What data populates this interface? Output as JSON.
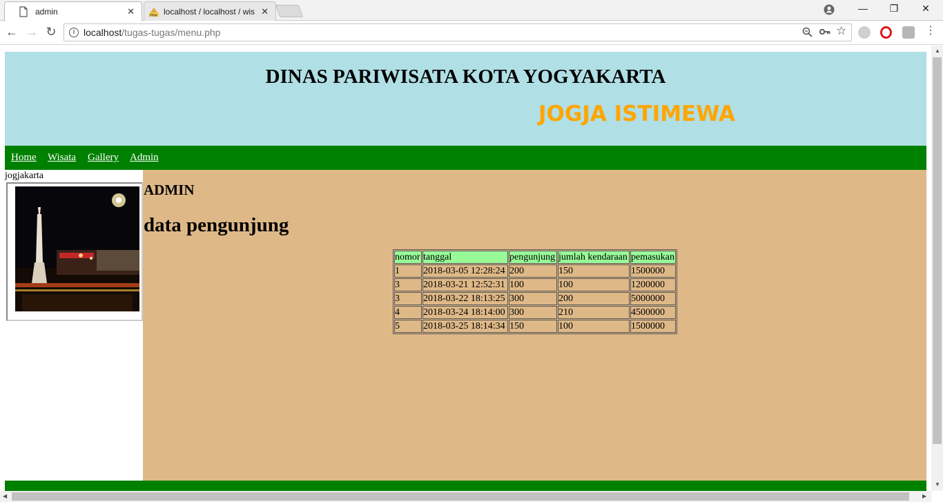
{
  "browser": {
    "tabs": [
      {
        "title": "admin",
        "active": true,
        "icon": "page-icon"
      },
      {
        "title": "localhost / localhost / wis",
        "active": false,
        "icon": "phpmyadmin-icon"
      }
    ],
    "url_host": "localhost",
    "url_path": "/tugas-tugas/menu.php"
  },
  "header": {
    "title": "DINAS PARIWISATA KOTA YOGYAKARTA",
    "tagline": "JOGJA ISTIMEWA"
  },
  "nav": {
    "items": [
      "Home",
      "Wisata",
      "Gallery",
      "Admin"
    ]
  },
  "sidebar": {
    "caption": "jogjakarta"
  },
  "content": {
    "heading": "ADMIN",
    "subheading": "data pengunjung",
    "table": {
      "columns": [
        "nomor",
        "tanggal",
        "pengunjung",
        "jumlah kendaraan",
        "pemasukan"
      ],
      "rows": [
        [
          "1",
          "2018-03-05 12:28:24",
          "200",
          "150",
          "1500000"
        ],
        [
          "3",
          "2018-03-21 12:52:31",
          "100",
          "100",
          "1200000"
        ],
        [
          "3",
          "2018-03-22 18:13:25",
          "300",
          "200",
          "5000000"
        ],
        [
          "4",
          "2018-03-24 18:14:00",
          "300",
          "210",
          "4500000"
        ],
        [
          "5",
          "2018-03-25 18:14:34",
          "150",
          "100",
          "1500000"
        ]
      ]
    }
  },
  "colors": {
    "header_bg": "#b0dfe5",
    "tagline": "#ffa500",
    "menubar": "#008000",
    "content_bg": "#deb887",
    "table_header": "#98fb98"
  }
}
